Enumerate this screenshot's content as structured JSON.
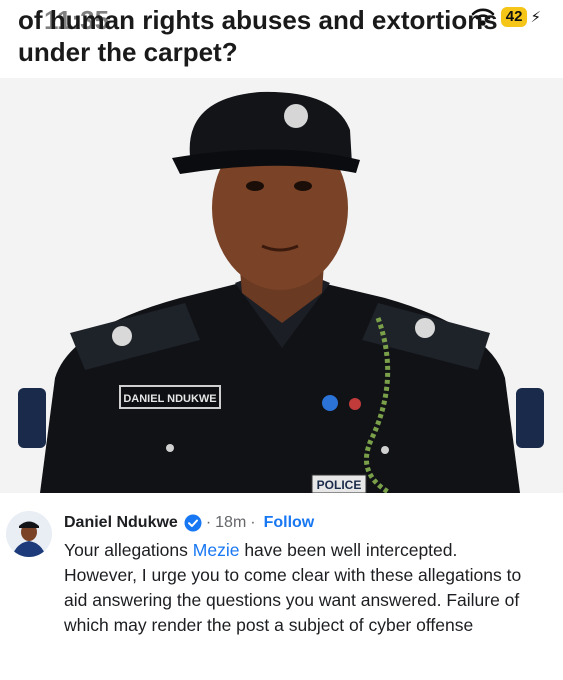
{
  "status_bar": {
    "time": "11:35",
    "battery": "42",
    "icons": [
      "wifi-icon",
      "battery-icon"
    ]
  },
  "headline": {
    "line1": "of human rights abuses and extortions",
    "line2": "under the carpet?"
  },
  "photo": {
    "name_tag": "DANIEL NDUKWE",
    "badge": "POLICE"
  },
  "comment": {
    "author": "Daniel Ndukwe",
    "verified_icon": "verified-badge-icon",
    "separator": "·",
    "time": "18m",
    "follow_label": "Follow",
    "text_before_mention": "Your allegations ",
    "mention": "Mezie",
    "text_after_mention": " have been well intercepted. However, I urge you to come clear with these allegations to aid answering the questions you want answered. Failure of which may render the post a subject of cyber offense"
  },
  "colors": {
    "link_blue": "#1877f2",
    "uniform": "#101216",
    "battery_yellow": "#f5c518"
  }
}
